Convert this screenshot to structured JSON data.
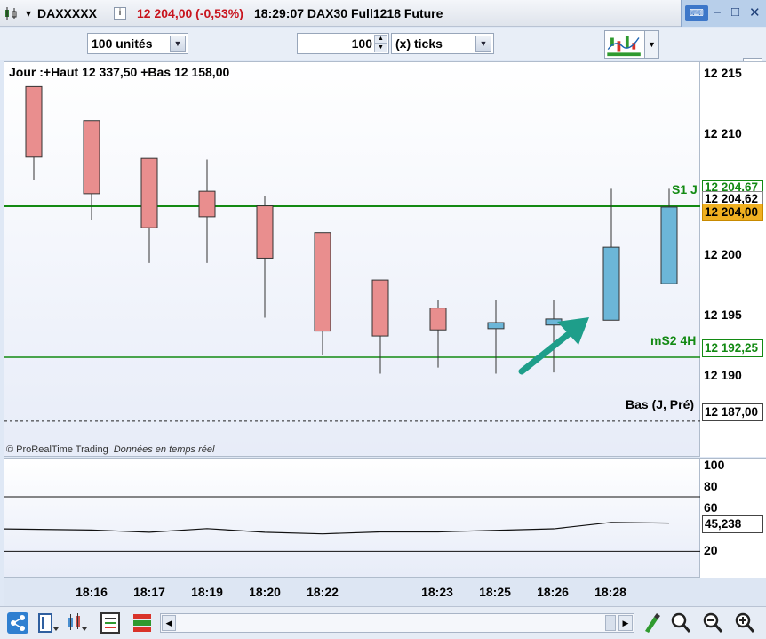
{
  "title_bar": {
    "symbol": "DAXXXXX",
    "price_change": "12 204,00 (-0,53%)",
    "time_instrument": "18:29:07 DAX30 Full1218 Future",
    "colors": {
      "change": "#c8141e"
    }
  },
  "toolbar": {
    "units": "100 unités",
    "tick_count": "100",
    "tick_mode": "(x) ticks"
  },
  "chart": {
    "header": "Jour :+Haut 12 337,50 +Bas 12 158,00",
    "watermark": "© ProRealTime Trading",
    "watermark_note": "Données en temps réel",
    "price_ticks": [
      "12 215",
      "12 210",
      "12 200",
      "12 195",
      "12 190"
    ],
    "levels": {
      "s1_label": "S1 J",
      "s1_value": "12 204,67",
      "last_extra": "12 204,62",
      "current_price": "12 204,00",
      "ms2_label": "mS2 4H",
      "ms2_value": "12 192,25",
      "bas_label": "Bas (J, Pré)",
      "bas_value": "12 187,00"
    },
    "colors": {
      "bear": "#e98e8e",
      "bull": "#6cb6d8",
      "level_line": "#138a13",
      "price_tag": "#f0b020",
      "arrow": "#1e9e8a"
    }
  },
  "oscillator": {
    "ticks": [
      "100",
      "80",
      "60",
      "20"
    ],
    "current_value": "45,238"
  },
  "time_axis": {
    "labels": [
      "18:16",
      "18:17",
      "18:19",
      "18:20",
      "18:22",
      "18:23",
      "18:25",
      "18:26",
      "18:28"
    ]
  },
  "chart_data": {
    "type": "candlestick",
    "ylim": [
      12184,
      12216.5
    ],
    "candles": [
      {
        "open": 12214.5,
        "close": 12208.7,
        "high": 12214.5,
        "low": 12206.8
      },
      {
        "open": 12211.7,
        "close": 12205.7,
        "high": 12211.7,
        "low": 12203.5
      },
      {
        "open": 12208.6,
        "close": 12202.9,
        "high": 12208.6,
        "low": 12200.0
      },
      {
        "open": 12205.9,
        "close": 12203.8,
        "high": 12208.5,
        "low": 12200.0
      },
      {
        "open": 12204.7,
        "close": 12200.4,
        "high": 12205.5,
        "low": 12195.5
      },
      {
        "open": 12202.5,
        "close": 12194.4,
        "high": 12202.5,
        "low": 12192.4
      },
      {
        "open": 12198.6,
        "close": 12194.0,
        "high": 12198.6,
        "low": 12190.9
      },
      {
        "open": 12196.3,
        "close": 12194.5,
        "high": 12197.0,
        "low": 12191.4
      },
      {
        "open": 12194.6,
        "close": 12195.1,
        "high": 12197.0,
        "low": 12190.9
      },
      {
        "open": 12194.9,
        "close": 12195.4,
        "high": 12197.0,
        "low": 12191.0
      },
      {
        "open": 12195.3,
        "close": 12201.3,
        "high": 12206.1,
        "low": 12195.3
      },
      {
        "open": 12198.3,
        "close": 12204.6,
        "high": 12206.1,
        "low": 12198.3
      }
    ],
    "oscillator_series": [
      45.5,
      44.5,
      42.5,
      45.8,
      42.5,
      41.0,
      42.8,
      42.8,
      44.2,
      45.6,
      51.5,
      50.8
    ],
    "oscillator_ylim": [
      0,
      110
    ],
    "oscillator_levels": [
      75,
      25
    ]
  }
}
